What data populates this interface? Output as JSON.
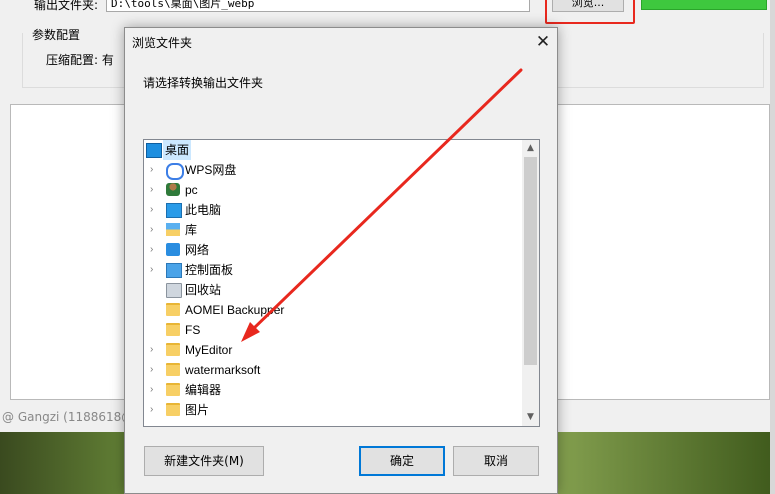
{
  "app": {
    "output_folder_label": "输出文件夹:",
    "output_folder_value": "D:\\tools\\桌面\\图片_webp",
    "browse_label": "浏览...",
    "params_label": "参数配置",
    "compress_label": "压缩配置: 有",
    "credit": "@ Gangzi (1188618@"
  },
  "dialog": {
    "title": "浏览文件夹",
    "prompt": "请选择转换输出文件夹",
    "tree": [
      {
        "label": "桌面",
        "icon": "desktop-icon",
        "expandable": false,
        "selected": true,
        "indent": 0
      },
      {
        "label": "WPS网盘",
        "icon": "cloud-icon",
        "expandable": true,
        "selected": false,
        "indent": 1
      },
      {
        "label": "pc",
        "icon": "user-icon",
        "expandable": true,
        "selected": false,
        "indent": 1
      },
      {
        "label": "此电脑",
        "icon": "computer-icon",
        "expandable": true,
        "selected": false,
        "indent": 1
      },
      {
        "label": "库",
        "icon": "library-icon",
        "expandable": true,
        "selected": false,
        "indent": 1
      },
      {
        "label": "网络",
        "icon": "network-icon",
        "expandable": true,
        "selected": false,
        "indent": 1
      },
      {
        "label": "控制面板",
        "icon": "control-panel-icon",
        "expandable": true,
        "selected": false,
        "indent": 1
      },
      {
        "label": "回收站",
        "icon": "recycle-bin-icon",
        "expandable": false,
        "selected": false,
        "indent": 1
      },
      {
        "label": "AOMEI Backupper",
        "icon": "folder-icon",
        "expandable": false,
        "selected": false,
        "indent": 1
      },
      {
        "label": "FS",
        "icon": "folder-icon",
        "expandable": false,
        "selected": false,
        "indent": 1
      },
      {
        "label": "MyEditor",
        "icon": "folder-icon",
        "expandable": true,
        "selected": false,
        "indent": 1
      },
      {
        "label": "watermarksoft",
        "icon": "folder-icon",
        "expandable": true,
        "selected": false,
        "indent": 1
      },
      {
        "label": "编辑器",
        "icon": "folder-icon",
        "expandable": true,
        "selected": false,
        "indent": 1
      },
      {
        "label": "图片",
        "icon": "folder-icon",
        "expandable": true,
        "selected": false,
        "indent": 1
      }
    ],
    "new_folder_label": "新建文件夹(M)",
    "ok_label": "确定",
    "cancel_label": "取消"
  },
  "annotation": {
    "arrow_color": "#e8281e",
    "highlight_color": "#e8281e"
  },
  "colors": {
    "selection": "#cce8ff",
    "primary_border": "#0078d7",
    "green_button": "#3ec83e"
  }
}
